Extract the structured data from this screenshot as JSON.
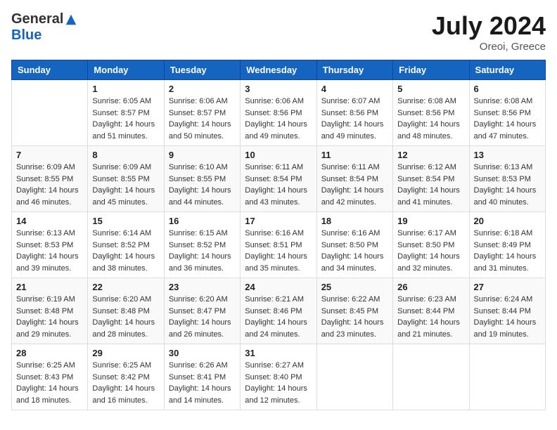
{
  "header": {
    "logo_general": "General",
    "logo_blue": "Blue",
    "month_year": "July 2024",
    "location": "Oreoi, Greece"
  },
  "calendar": {
    "days_of_week": [
      "Sunday",
      "Monday",
      "Tuesday",
      "Wednesday",
      "Thursday",
      "Friday",
      "Saturday"
    ],
    "weeks": [
      [
        {
          "day": "",
          "info": ""
        },
        {
          "day": "1",
          "info": "Sunrise: 6:05 AM\nSunset: 8:57 PM\nDaylight: 14 hours\nand 51 minutes."
        },
        {
          "day": "2",
          "info": "Sunrise: 6:06 AM\nSunset: 8:57 PM\nDaylight: 14 hours\nand 50 minutes."
        },
        {
          "day": "3",
          "info": "Sunrise: 6:06 AM\nSunset: 8:56 PM\nDaylight: 14 hours\nand 49 minutes."
        },
        {
          "day": "4",
          "info": "Sunrise: 6:07 AM\nSunset: 8:56 PM\nDaylight: 14 hours\nand 49 minutes."
        },
        {
          "day": "5",
          "info": "Sunrise: 6:08 AM\nSunset: 8:56 PM\nDaylight: 14 hours\nand 48 minutes."
        },
        {
          "day": "6",
          "info": "Sunrise: 6:08 AM\nSunset: 8:56 PM\nDaylight: 14 hours\nand 47 minutes."
        }
      ],
      [
        {
          "day": "7",
          "info": "Sunrise: 6:09 AM\nSunset: 8:55 PM\nDaylight: 14 hours\nand 46 minutes."
        },
        {
          "day": "8",
          "info": "Sunrise: 6:09 AM\nSunset: 8:55 PM\nDaylight: 14 hours\nand 45 minutes."
        },
        {
          "day": "9",
          "info": "Sunrise: 6:10 AM\nSunset: 8:55 PM\nDaylight: 14 hours\nand 44 minutes."
        },
        {
          "day": "10",
          "info": "Sunrise: 6:11 AM\nSunset: 8:54 PM\nDaylight: 14 hours\nand 43 minutes."
        },
        {
          "day": "11",
          "info": "Sunrise: 6:11 AM\nSunset: 8:54 PM\nDaylight: 14 hours\nand 42 minutes."
        },
        {
          "day": "12",
          "info": "Sunrise: 6:12 AM\nSunset: 8:54 PM\nDaylight: 14 hours\nand 41 minutes."
        },
        {
          "day": "13",
          "info": "Sunrise: 6:13 AM\nSunset: 8:53 PM\nDaylight: 14 hours\nand 40 minutes."
        }
      ],
      [
        {
          "day": "14",
          "info": "Sunrise: 6:13 AM\nSunset: 8:53 PM\nDaylight: 14 hours\nand 39 minutes."
        },
        {
          "day": "15",
          "info": "Sunrise: 6:14 AM\nSunset: 8:52 PM\nDaylight: 14 hours\nand 38 minutes."
        },
        {
          "day": "16",
          "info": "Sunrise: 6:15 AM\nSunset: 8:52 PM\nDaylight: 14 hours\nand 36 minutes."
        },
        {
          "day": "17",
          "info": "Sunrise: 6:16 AM\nSunset: 8:51 PM\nDaylight: 14 hours\nand 35 minutes."
        },
        {
          "day": "18",
          "info": "Sunrise: 6:16 AM\nSunset: 8:50 PM\nDaylight: 14 hours\nand 34 minutes."
        },
        {
          "day": "19",
          "info": "Sunrise: 6:17 AM\nSunset: 8:50 PM\nDaylight: 14 hours\nand 32 minutes."
        },
        {
          "day": "20",
          "info": "Sunrise: 6:18 AM\nSunset: 8:49 PM\nDaylight: 14 hours\nand 31 minutes."
        }
      ],
      [
        {
          "day": "21",
          "info": "Sunrise: 6:19 AM\nSunset: 8:48 PM\nDaylight: 14 hours\nand 29 minutes."
        },
        {
          "day": "22",
          "info": "Sunrise: 6:20 AM\nSunset: 8:48 PM\nDaylight: 14 hours\nand 28 minutes."
        },
        {
          "day": "23",
          "info": "Sunrise: 6:20 AM\nSunset: 8:47 PM\nDaylight: 14 hours\nand 26 minutes."
        },
        {
          "day": "24",
          "info": "Sunrise: 6:21 AM\nSunset: 8:46 PM\nDaylight: 14 hours\nand 24 minutes."
        },
        {
          "day": "25",
          "info": "Sunrise: 6:22 AM\nSunset: 8:45 PM\nDaylight: 14 hours\nand 23 minutes."
        },
        {
          "day": "26",
          "info": "Sunrise: 6:23 AM\nSunset: 8:44 PM\nDaylight: 14 hours\nand 21 minutes."
        },
        {
          "day": "27",
          "info": "Sunrise: 6:24 AM\nSunset: 8:44 PM\nDaylight: 14 hours\nand 19 minutes."
        }
      ],
      [
        {
          "day": "28",
          "info": "Sunrise: 6:25 AM\nSunset: 8:43 PM\nDaylight: 14 hours\nand 18 minutes."
        },
        {
          "day": "29",
          "info": "Sunrise: 6:25 AM\nSunset: 8:42 PM\nDaylight: 14 hours\nand 16 minutes."
        },
        {
          "day": "30",
          "info": "Sunrise: 6:26 AM\nSunset: 8:41 PM\nDaylight: 14 hours\nand 14 minutes."
        },
        {
          "day": "31",
          "info": "Sunrise: 6:27 AM\nSunset: 8:40 PM\nDaylight: 14 hours\nand 12 minutes."
        },
        {
          "day": "",
          "info": ""
        },
        {
          "day": "",
          "info": ""
        },
        {
          "day": "",
          "info": ""
        }
      ]
    ]
  }
}
